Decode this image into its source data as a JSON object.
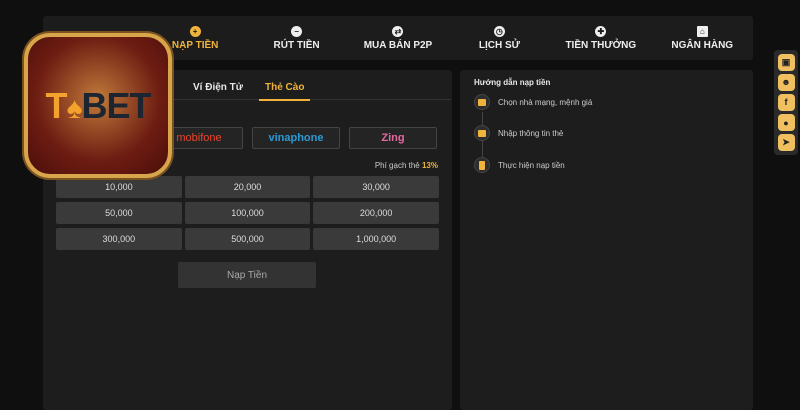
{
  "nav": [
    {
      "label": "",
      "icon": "user-icon"
    },
    {
      "label": "NẠP TIỀN",
      "icon": "plus-icon",
      "active": true
    },
    {
      "label": "RÚT TIỀN",
      "icon": "minus-icon"
    },
    {
      "label": "MUA BÁN P2P",
      "icon": "exchange-icon"
    },
    {
      "label": "LỊCH SỬ",
      "icon": "clock-icon"
    },
    {
      "label": "TIỀN THƯỞNG",
      "icon": "gift-icon"
    },
    {
      "label": "NGÂN HÀNG",
      "icon": "bank-icon"
    }
  ],
  "tabs": {
    "ewallet": "Ví Điện Tử",
    "card": "Thẻ Cào"
  },
  "carriers": {
    "mobifone": "mobifone",
    "vinaphone": "vinaphone",
    "zing": "Zing"
  },
  "fee": {
    "label": "Phí gạch thẻ",
    "value": "13%"
  },
  "amounts": [
    "10,000",
    "20,000",
    "30,000",
    "50,000",
    "100,000",
    "200,000",
    "300,000",
    "500,000",
    "1,000,000"
  ],
  "submit_label": "Nạp Tiền",
  "guide": {
    "title": "Hướng dẫn nạp tiền",
    "steps": [
      "Chọn nhà mạng, mệnh giá",
      "Nhập thông tin thẻ",
      "Thực hiện nạp tiền"
    ]
  },
  "logo": {
    "text_a": "TO",
    "text_b": "BET"
  },
  "side_buttons": [
    "gift-icon",
    "group-icon",
    "facebook-icon",
    "chat-icon",
    "telegram-icon"
  ],
  "colors": {
    "accent": "#f0b43c",
    "background": "#0f0f0f",
    "panel": "#1d1d1d"
  }
}
